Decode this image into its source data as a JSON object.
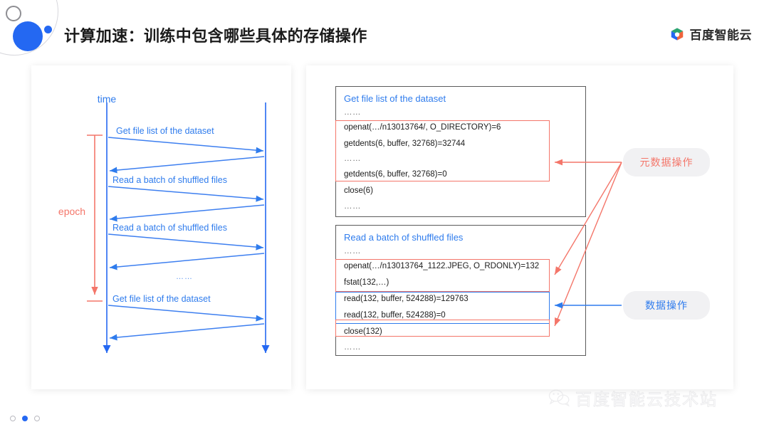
{
  "header": {
    "title": "计算加速：训练中包含哪些具体的存储操作",
    "brand_text": "百度智能云",
    "brand_logo_icon": "baidu-cloud-cube-logo"
  },
  "sequence_diagram": {
    "time_axis_label": "time",
    "epoch_label": "epoch",
    "ellipsis": "……",
    "messages": [
      {
        "label": "Get file list of the dataset",
        "direction": "right"
      },
      {
        "label": "",
        "direction": "left"
      },
      {
        "label": "Read a batch of shuffled files",
        "direction": "right"
      },
      {
        "label": "",
        "direction": "left"
      },
      {
        "label": "Read a batch of shuffled files",
        "direction": "right"
      },
      {
        "label": "",
        "direction": "left"
      },
      {
        "label": "Get file list of the dataset",
        "direction": "right"
      },
      {
        "label": "",
        "direction": "left"
      }
    ]
  },
  "detail_panel": {
    "metadata_box": {
      "title": "Get file list of the dataset",
      "lines": [
        "……",
        "openat(…/n13013764/, O_DIRECTORY)=6",
        "getdents(6, buffer, 32768)=32744",
        "……",
        "getdents(6, buffer, 32768)=0",
        "close(6)",
        "……"
      ]
    },
    "data_box": {
      "title": "Read a batch of shuffled files",
      "lines": [
        "……",
        "openat(…/n13013764_1122.JPEG, O_RDONLY)=132",
        "fstat(132,…)",
        "read(132, buffer, 524288)=129763",
        "read(132, buffer, 524288)=0",
        "close(132)",
        "……"
      ]
    }
  },
  "legend": {
    "metadata_label": "元数据操作",
    "data_label": "数据操作"
  },
  "watermark": {
    "text": "百度智能云技术站",
    "icon": "wechat-icon"
  },
  "pagination": {
    "dots": [
      "off",
      "on",
      "off"
    ]
  },
  "colors": {
    "brand_blue": "#2468f2",
    "accent_blue": "#2f7ced",
    "accent_red": "#f4766a",
    "box_border": "#5b5b5b",
    "pill_bg": "#f1f1f3",
    "title_text": "#1b1b1b"
  }
}
